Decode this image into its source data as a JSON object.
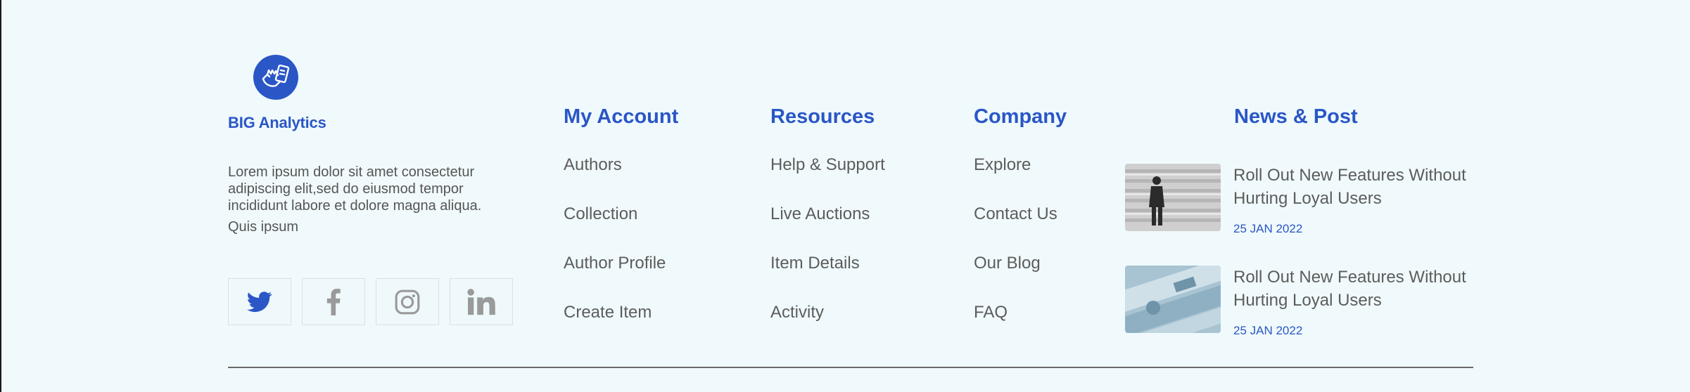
{
  "brand": {
    "name": "BIG Analytics",
    "description_lines": [
      "Lorem ipsum dolor sit amet consectetur",
      "adipiscing elit,sed do eiusmod tempor",
      "incididunt labore et dolore magna aliqua.",
      "Quis ipsum"
    ],
    "logo_icon": "hand-money-icon",
    "accent_color": "#2a56c6"
  },
  "socials": [
    {
      "name": "twitter",
      "icon": "twitter-icon",
      "color": "#2a56c6"
    },
    {
      "name": "facebook",
      "icon": "facebook-icon",
      "color": "#9a9a9a"
    },
    {
      "name": "instagram",
      "icon": "instagram-icon",
      "color": "#9a9a9a"
    },
    {
      "name": "linkedin",
      "icon": "linkedin-icon",
      "color": "#9a9a9a"
    }
  ],
  "columns": [
    {
      "title": "My Account",
      "links": [
        "Authors",
        "Collection",
        "Author Profile",
        "Create Item"
      ]
    },
    {
      "title": "Resources",
      "links": [
        "Help & Support",
        "Live Auctions",
        "Item Details",
        "Activity"
      ]
    },
    {
      "title": "Company",
      "links": [
        "Explore",
        "Contact Us",
        "Our Blog",
        "FAQ"
      ]
    }
  ],
  "news": {
    "title": "News & Post",
    "posts": [
      {
        "title_line1": "Roll Out New Features Without",
        "title_line2": "Hurting Loyal Users",
        "date": "25 JAN 2022"
      },
      {
        "title_line1": "Roll Out New Features Without",
        "title_line2": "Hurting Loyal Users",
        "date": "25 JAN 2022"
      }
    ]
  }
}
